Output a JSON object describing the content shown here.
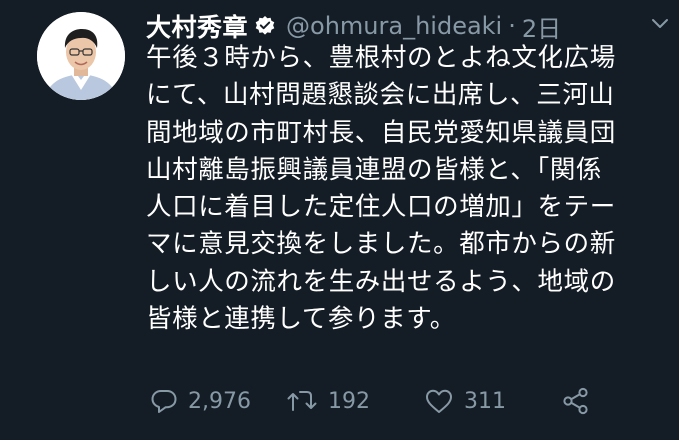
{
  "tweet": {
    "author": {
      "display_name": "大村秀章",
      "handle": "@ohmura_hideaki",
      "verified": true
    },
    "separator": "·",
    "time": "2日",
    "text_lines": [
      "午後３時から、豊根村のとよね文化広場",
      "にて、山村問題懇談会に出席し、三河山",
      "間地域の市町村長、自民党愛知県議員団",
      "山村離島振興議員連盟の皆様と、「関係",
      "人口に着目した定住人口の増加」をテー",
      "マに意見交換をしました。都市からの新",
      "しい人の流れを生み出せるよう、地域の",
      "皆様と連携して参ります。"
    ],
    "actions": {
      "reply": {
        "icon": "reply-icon",
        "count": "2,976"
      },
      "retweet": {
        "icon": "retweet-icon",
        "count": "192"
      },
      "like": {
        "icon": "heart-icon",
        "count": "311"
      },
      "share": {
        "icon": "share-icon"
      }
    }
  },
  "colors": {
    "background": "#141d26",
    "text": "#ffffff",
    "muted": "#8899a6",
    "verified_badge": "#ffffff"
  }
}
